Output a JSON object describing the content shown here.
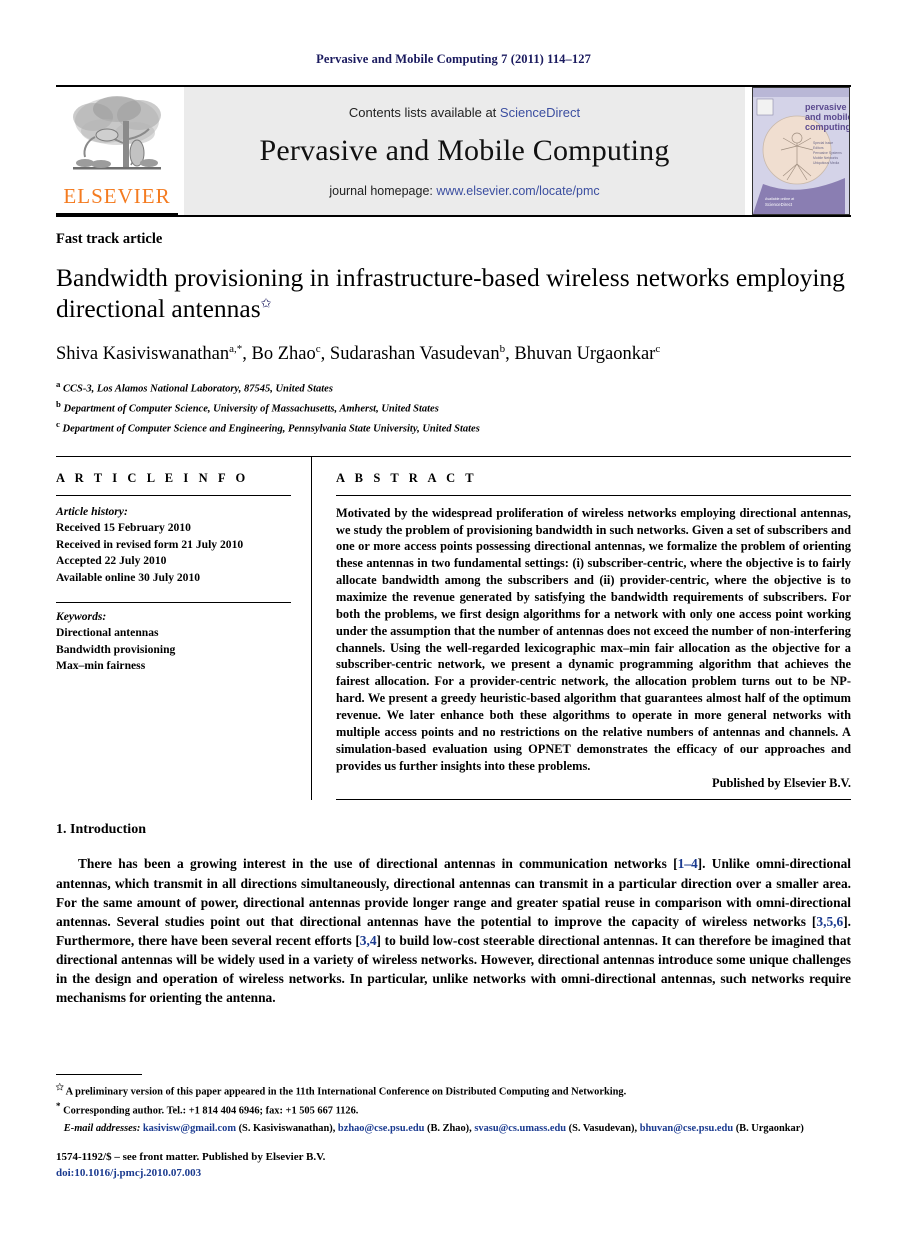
{
  "running_head": "Pervasive and Mobile Computing 7 (2011) 114–127",
  "banner": {
    "contents_prefix": "Contents lists available at ",
    "sciencedirect": "ScienceDirect",
    "journal_title": "Pervasive and Mobile Computing",
    "homepage_prefix": "journal homepage: ",
    "homepage_url": "www.elsevier.com/locate/pmc",
    "publisher_logo_text": "ELSEVIER",
    "cover_title_line1": "pervasive",
    "cover_title_line2": "and mobile",
    "cover_title_line3": "computing",
    "colors": {
      "link_blue": "#3b4ea0",
      "elsevier_orange": "#F47B20",
      "banner_grey": "#ebebeb",
      "cover_purple": "#6b5b9a"
    }
  },
  "article": {
    "type": "Fast track article",
    "title": "Bandwidth provisioning in infrastructure-based wireless networks employing directional antennas",
    "title_marker": "✩",
    "authors_html": "Shiva Kasiviswanathan <sup>a,*</sup>, Bo Zhao <sup>c</sup>, Sudarashan Vasudevan <sup>b</sup>, Bhuvan Urgaonkar <sup>c</sup>",
    "affiliations": [
      {
        "mark": "a",
        "text": "CCS-3, Los Alamos National Laboratory, 87545, United States"
      },
      {
        "mark": "b",
        "text": "Department of Computer Science, University of Massachusetts, Amherst, United States"
      },
      {
        "mark": "c",
        "text": "Department of Computer Science and Engineering, Pennsylvania State University, United States"
      }
    ]
  },
  "info": {
    "heading": "A R T I C L E   I N F O",
    "history_label": "Article history:",
    "history": [
      "Received 15 February 2010",
      "Received in revised form 21 July 2010",
      "Accepted 22 July 2010",
      "Available online 30 July 2010"
    ],
    "keywords_label": "Keywords:",
    "keywords": [
      "Directional antennas",
      "Bandwidth provisioning",
      "Max–min fairness"
    ]
  },
  "abstract": {
    "heading": "A B S T R A C T",
    "text": "Motivated by the widespread proliferation of wireless networks employing directional antennas, we study the problem of provisioning bandwidth in such networks. Given a set of subscribers and one or more access points possessing directional antennas, we formalize the problem of orienting these antennas in two fundamental settings: (i) subscriber-centric, where the objective is to fairly allocate bandwidth among the subscribers and (ii) provider-centric, where the objective is to maximize the revenue generated by satisfying the bandwidth requirements of subscribers. For both the problems, we first design algorithms for a network with only one access point working under the assumption that the number of antennas does not exceed the number of non-interfering channels. Using the well-regarded lexicographic max–min fair allocation as the objective for a subscriber-centric network, we present a dynamic programming algorithm that achieves the fairest allocation. For a provider-centric network, the allocation problem turns out to be NP-hard. We present a greedy heuristic-based algorithm that guarantees almost half of the optimum revenue. We later enhance both these algorithms to operate in more general networks with multiple access points and no restrictions on the relative numbers of antennas and channels. A simulation-based evaluation using OPNET demonstrates the efficacy of our approaches and provides us further insights into these problems.",
    "published_by": "Published by Elsevier B.V."
  },
  "body": {
    "section_number_title": "1.  Introduction",
    "paragraph_parts": {
      "p1_a": "There has been a growing interest in the use of directional antennas in communication networks [",
      "p1_cite1": "1–4",
      "p1_b": "]. Unlike omni-directional antennas, which transmit in all directions simultaneously, directional antennas can transmit in a particular direction over a smaller area. For the same amount of power, directional antennas provide longer range and greater spatial reuse in comparison with omni-directional antennas. Several studies point out that directional antennas have the potential to improve the capacity of wireless networks [",
      "p1_cite2": "3,5,6",
      "p1_c": "]. Furthermore, there have been several recent efforts [",
      "p1_cite3": "3,4",
      "p1_d": "] to build low-cost steerable directional antennas. It can therefore be imagined that directional antennas will be widely used in a variety of wireless networks. However, directional antennas introduce some unique challenges in the design and operation of wireless networks. In particular, unlike networks with omni-directional antennas, such networks require mechanisms for orienting the antenna."
    }
  },
  "footnotes": {
    "star_mark": "✩",
    "star_text": "A preliminary version of this paper appeared in the 11th International Conference on Distributed Computing and Networking.",
    "corresponding_mark": "*",
    "corresponding_text": "Corresponding author. Tel.: +1 814 404 6946; fax: +1 505 667 1126.",
    "email_label": "E-mail addresses:",
    "emails": [
      {
        "address": "kasivisw@gmail.com",
        "person": "(S. Kasiviswanathan)"
      },
      {
        "address": "bzhao@cse.psu.edu",
        "person": "(B. Zhao)"
      },
      {
        "address": "svasu@cs.umass.edu",
        "person": "(S. Vasudevan)"
      },
      {
        "address": "bhuvan@cse.psu.edu",
        "person": "(B. Urgaonkar)"
      }
    ],
    "front_matter": "1574-1192/$ – see front matter. Published by Elsevier B.V.",
    "doi": "doi:10.1016/j.pmcj.2010.07.003"
  }
}
